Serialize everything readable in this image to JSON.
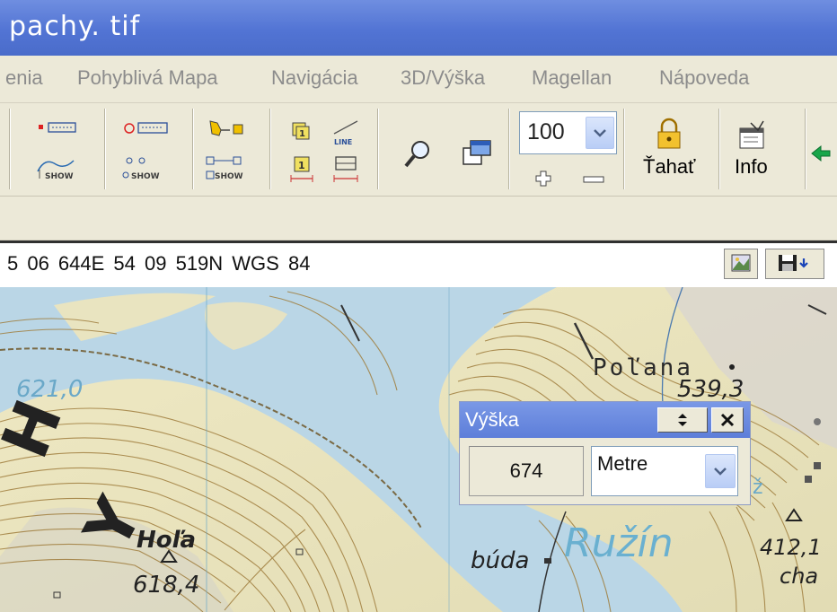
{
  "window": {
    "title": "pachy. tif"
  },
  "menu": {
    "items": [
      "enia",
      "Pohyblivá Mapa",
      "Navigácia",
      "3D/Výška",
      "Magellan",
      "Nápoveda"
    ]
  },
  "toolbar": {
    "show_label": "SHOW",
    "line_label": "LINE",
    "zoom_value": "100",
    "drag_label": "Ťahať",
    "info_label": "Info"
  },
  "status": {
    "coordinates": "5 06 644E  54 09 519N  WGS 84"
  },
  "map": {
    "labels": {
      "polana": "Poľana",
      "polana_height": "539,3",
      "hola": "Hoľa",
      "hola_height": "618,4",
      "buda": "búda",
      "ruzin": "Ružín",
      "peak": "412,1",
      "cha": "cha",
      "h_letter": "H",
      "y_letter": "Y",
      "blue_label": "621,0",
      "blue_z": "ž"
    }
  },
  "height_panel": {
    "title": "Výška",
    "value": "674",
    "unit": "Metre"
  },
  "colors": {
    "title_bar": "#5274d4",
    "water": "#bcd8e4",
    "land": "#e9e4c0",
    "contour": "#9a7a3c"
  }
}
